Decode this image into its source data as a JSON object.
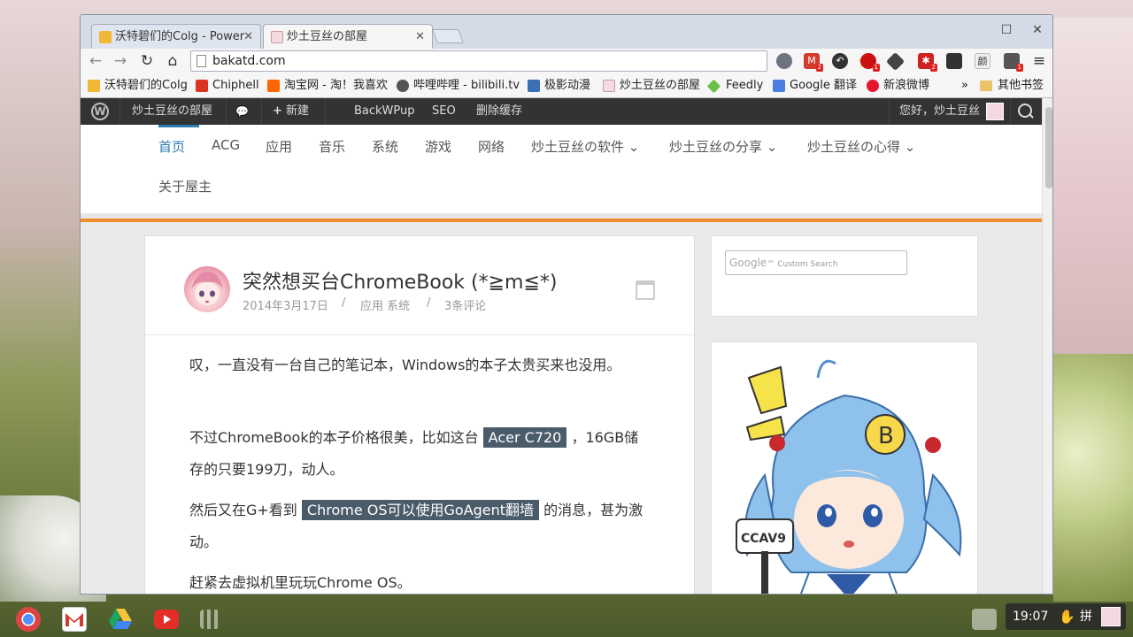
{
  "tabs": [
    {
      "title": "沃特碧们的Colg - Power",
      "fav_color": "#f0b836"
    },
    {
      "title": "炒土豆丝の部屋",
      "fav_color": "#f4dbe2"
    }
  ],
  "window": {
    "maximize_glyph": "☐",
    "close_glyph": "✕"
  },
  "toolbar": {
    "back_glyph": "←",
    "forward_glyph": "→",
    "reload_glyph": "↻",
    "home_glyph": "⌂",
    "url": "bakatd.com",
    "star_glyph": "★",
    "extensions": [
      {
        "name": "sync-extension-icon",
        "color": "#6d7480",
        "badge": ""
      },
      {
        "name": "gmail-extension-icon",
        "color": "#d23b2e",
        "badge": "2"
      },
      {
        "name": "undo-extension-icon",
        "color": "#333",
        "badge": ""
      },
      {
        "name": "adblock-extension-icon",
        "color": "#cc1111",
        "badge": "1"
      },
      {
        "name": "tampermonkey-extension-icon",
        "color": "#444",
        "badge": ""
      },
      {
        "name": "puzzle-extension-icon",
        "color": "#cc2222",
        "badge": "2"
      },
      {
        "name": "evernote-extension-icon",
        "color": "#333",
        "badge": ""
      },
      {
        "name": "font-extension-icon",
        "color": "#eee",
        "badge": "",
        "text": "颜"
      },
      {
        "name": "proxy-extension-icon",
        "color": "#555",
        "badge": "1"
      }
    ],
    "menu_glyph": "≡"
  },
  "bookmarks": {
    "items": [
      {
        "label": "沃特碧们的Colg",
        "color": "#f0b836"
      },
      {
        "label": "Chiphell",
        "color": "#d32"
      },
      {
        "label": "淘宝网 - 淘！我喜欢",
        "color": "#f60"
      },
      {
        "label": "哔哩哔哩 - bilibili.tv",
        "color": "#555"
      },
      {
        "label": "极影动漫",
        "color": "#3a6fb5"
      },
      {
        "label": "炒土豆丝の部屋",
        "color": "#f4dbe2"
      },
      {
        "label": "Feedly",
        "color": "#6cc04a"
      },
      {
        "label": "Google 翻译",
        "color": "#4a7fe0"
      },
      {
        "label": "新浪微博",
        "color": "#e6162d"
      }
    ],
    "overflow": "»",
    "other": "其他书签"
  },
  "adminbar": {
    "site_name": "炒土豆丝の部屋",
    "new_label": "新建",
    "new_plus": "+",
    "comment_glyph": "💬",
    "items": [
      "BackWPup",
      "SEO",
      "删除缓存"
    ],
    "greeting": "您好，炒土豆丝"
  },
  "nav": {
    "items": [
      "首页",
      "ACG",
      "应用",
      "音乐",
      "系统",
      "游戏",
      "网络",
      "炒土豆丝の软件 ⌄",
      "炒土豆丝の分享 ⌄",
      "炒土豆丝の心得 ⌄"
    ],
    "second_row": [
      "关于屋主"
    ]
  },
  "article": {
    "title": "突然想买台ChromeBook (*≧m≦*)",
    "date": "2014年3月17日",
    "sep": "/",
    "categories": "应用 系统",
    "comments": "3条评论",
    "paragraphs": [
      {
        "before": "叹，一直没有一台自己的笔记本，Windows的本子太贵买来也没用。",
        "highlight": "",
        "after": ""
      },
      {
        "before": "不过ChromeBook的本子价格很美，比如这台 ",
        "highlight": "Acer C720",
        "after": " ，16GB储存的只要199刀，动人。"
      },
      {
        "before": "然后又在G+看到 ",
        "highlight": "Chrome OS可以使用GoAgent翻墙",
        "after": " 的消息，甚为激动。"
      },
      {
        "before": "赶紧去虚拟机里玩玩Chrome OS。",
        "highlight": "",
        "after": ""
      }
    ]
  },
  "sidebar": {
    "search_brand": "Google",
    "search_text": "Custom Search"
  },
  "shelf": {
    "apps": [
      "chrome-app-icon",
      "gmail-app-icon",
      "drive-app-icon",
      "youtube-app-icon",
      "apps-launcher-icon"
    ],
    "time": "19:07",
    "ime": "拼"
  }
}
